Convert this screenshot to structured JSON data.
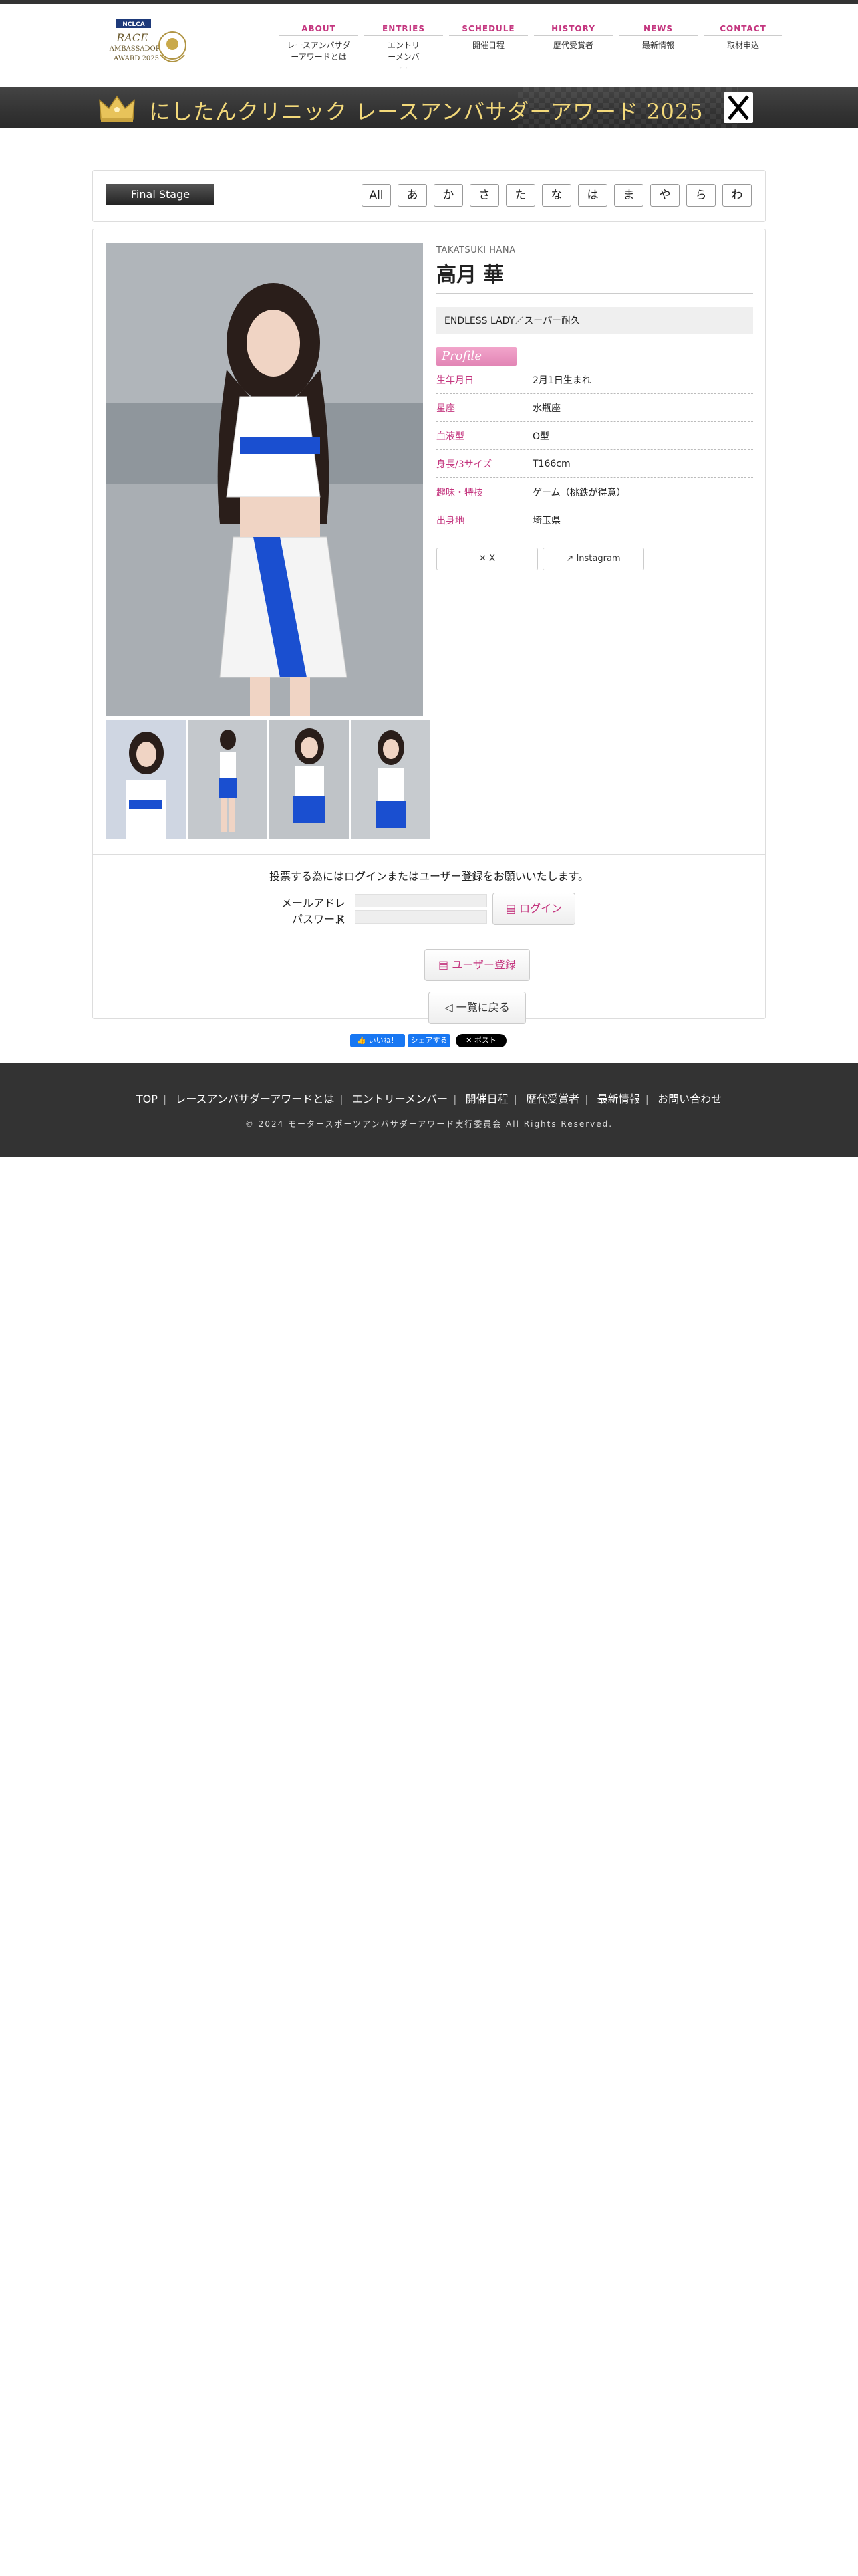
{
  "nav": [
    {
      "en": "ABOUT",
      "ja": "レースアンバサダーアワードとは"
    },
    {
      "en": "ENTRIES",
      "ja": "エントリーメンバー"
    },
    {
      "en": "SCHEDULE",
      "ja": "開催日程"
    },
    {
      "en": "HISTORY",
      "ja": "歴代受賞者"
    },
    {
      "en": "NEWS",
      "ja": "最新情報"
    },
    {
      "en": "CONTACT",
      "ja": "取材申込"
    }
  ],
  "logo": {
    "brand": "NCLCA",
    "line1": "RACE",
    "line2": "AMBASSADOR",
    "line3": "AWARD 2025"
  },
  "banner": {
    "title": "にしたんクリニック レースアンバサダーアワード 2025"
  },
  "filter": {
    "stage": "Final Stage",
    "kana": [
      "All",
      "あ",
      "か",
      "さ",
      "た",
      "な",
      "は",
      "ま",
      "や",
      "ら",
      "わ"
    ]
  },
  "profile": {
    "romaji": "TAKATSUKI HANA",
    "name": "高月 華",
    "team": "ENDLESS LADY／スーパー耐久",
    "tag": "Profile",
    "rows": [
      {
        "label": "生年月日",
        "value": "2月1日生まれ"
      },
      {
        "label": "星座",
        "value": "水瓶座"
      },
      {
        "label": "血液型",
        "value": "O型"
      },
      {
        "label": "身長/3サイズ",
        "value": "T166cm"
      },
      {
        "label": "趣味・特技",
        "value": "ゲーム（桃鉄が得意）"
      },
      {
        "label": "出身地",
        "value": "埼玉県"
      }
    ],
    "sns": [
      "X",
      "Instagram"
    ]
  },
  "vote": {
    "message": "投票する為にはログインまたはユーザー登録をお願いいたします。",
    "mail_label": "メールアドレス",
    "pass_label": "パスワード",
    "login": "ログイン",
    "register": "ユーザー登録",
    "back": "一覧に戻る"
  },
  "social": {
    "like": "いいね！",
    "share": "シェアする",
    "post": "ポスト"
  },
  "footer": {
    "links": [
      "TOP",
      "レースアンバサダーアワードとは",
      "エントリーメンバー",
      "開催日程",
      "歴代受賞者",
      "最新情報",
      "お問い合わせ"
    ],
    "copyright": "© 2024 モータースポーツアンバサダーアワード実行委員会 All Rights Reserved."
  },
  "colors": {
    "accent": "#c4367f",
    "gold": "#f3d97a",
    "dark": "#333333"
  }
}
